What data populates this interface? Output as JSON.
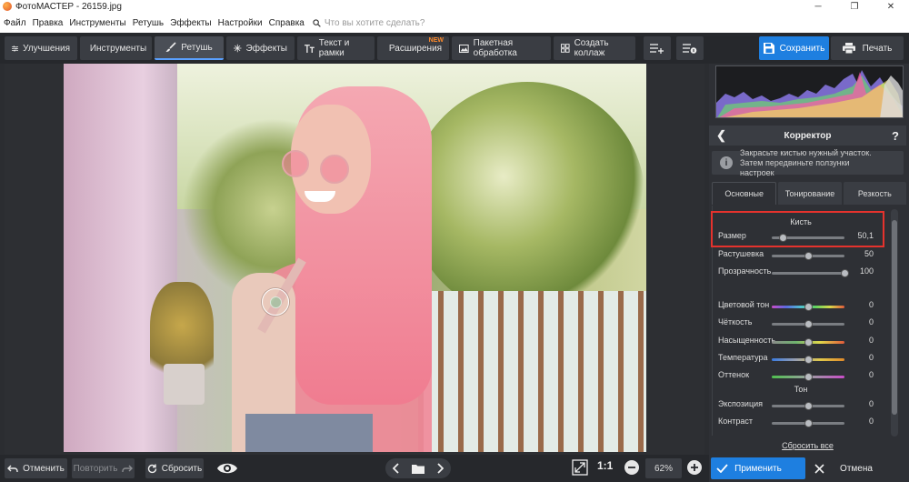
{
  "window": {
    "title": "ФотоМАСТЕР - 26159.jpg"
  },
  "menu": {
    "items": [
      "Файл",
      "Правка",
      "Инструменты",
      "Ретушь",
      "Эффекты",
      "Настройки",
      "Справка"
    ],
    "search_placeholder": "Что вы хотите сделать?"
  },
  "toolbar": {
    "tabs": [
      {
        "label": "Улучшения",
        "icon": "sliders-icon",
        "active": false
      },
      {
        "label": "Инструменты",
        "icon": "crop-icon",
        "active": false
      },
      {
        "label": "Ретушь",
        "icon": "brush-icon",
        "active": true
      },
      {
        "label": "Эффекты",
        "icon": "sparkle-icon",
        "active": false
      },
      {
        "label": "Текст и рамки",
        "icon": "text-icon",
        "active": false
      },
      {
        "label": "Расширения",
        "icon": "plus-icon",
        "active": false,
        "badge": "NEW"
      },
      {
        "label": "Пакетная обработка",
        "icon": "image-icon",
        "active": false
      },
      {
        "label": "Создать коллаж",
        "icon": "collage-icon",
        "active": false
      }
    ],
    "save_label": "Сохранить",
    "print_label": "Печать"
  },
  "bottom": {
    "undo_label": "Отменить",
    "redo_label": "Повторить",
    "reset_label": "Сбросить",
    "zoom_ratio_label": "1:1",
    "zoom_value": "62%"
  },
  "panel": {
    "title": "Корректор",
    "hint": "Закрасьте кистью нужный участок. Затем передвиньте ползунки настроек",
    "tabs": [
      "Основные",
      "Тонирование",
      "Резкость"
    ],
    "active_tab": 0,
    "brush_section": "Кисть",
    "brush_rows": [
      {
        "label": "Размер",
        "value": "50,1",
        "fraction": 0.15,
        "track": "gray"
      },
      {
        "label": "Растушевка",
        "value": "50",
        "fraction": 0.5,
        "track": "gray"
      },
      {
        "label": "Прозрачность",
        "value": "100",
        "fraction": 1.0,
        "track": "gray"
      }
    ],
    "adjust_rows": [
      {
        "label": "Цветовой тон",
        "value": "0",
        "fraction": 0.5,
        "track": "hue"
      },
      {
        "label": "Чёткость",
        "value": "0",
        "fraction": 0.5,
        "track": "gray"
      },
      {
        "label": "Насыщенность",
        "value": "0",
        "fraction": 0.5,
        "track": "sat"
      },
      {
        "label": "Температура",
        "value": "0",
        "fraction": 0.5,
        "track": "temp"
      },
      {
        "label": "Оттенок",
        "value": "0",
        "fraction": 0.5,
        "track": "tint"
      }
    ],
    "tone_section": "Тон",
    "tone_rows": [
      {
        "label": "Экспозиция",
        "value": "0",
        "fraction": 0.5,
        "track": "gray"
      },
      {
        "label": "Контраст",
        "value": "0",
        "fraction": 0.5,
        "track": "gray"
      }
    ],
    "reset_all_label": "Сбросить все",
    "apply_label": "Применить",
    "cancel_label": "Отмена"
  },
  "colors": {
    "accent": "#1e7fe0",
    "highlight": "#e5322d",
    "badge": "#ff8a2a"
  }
}
